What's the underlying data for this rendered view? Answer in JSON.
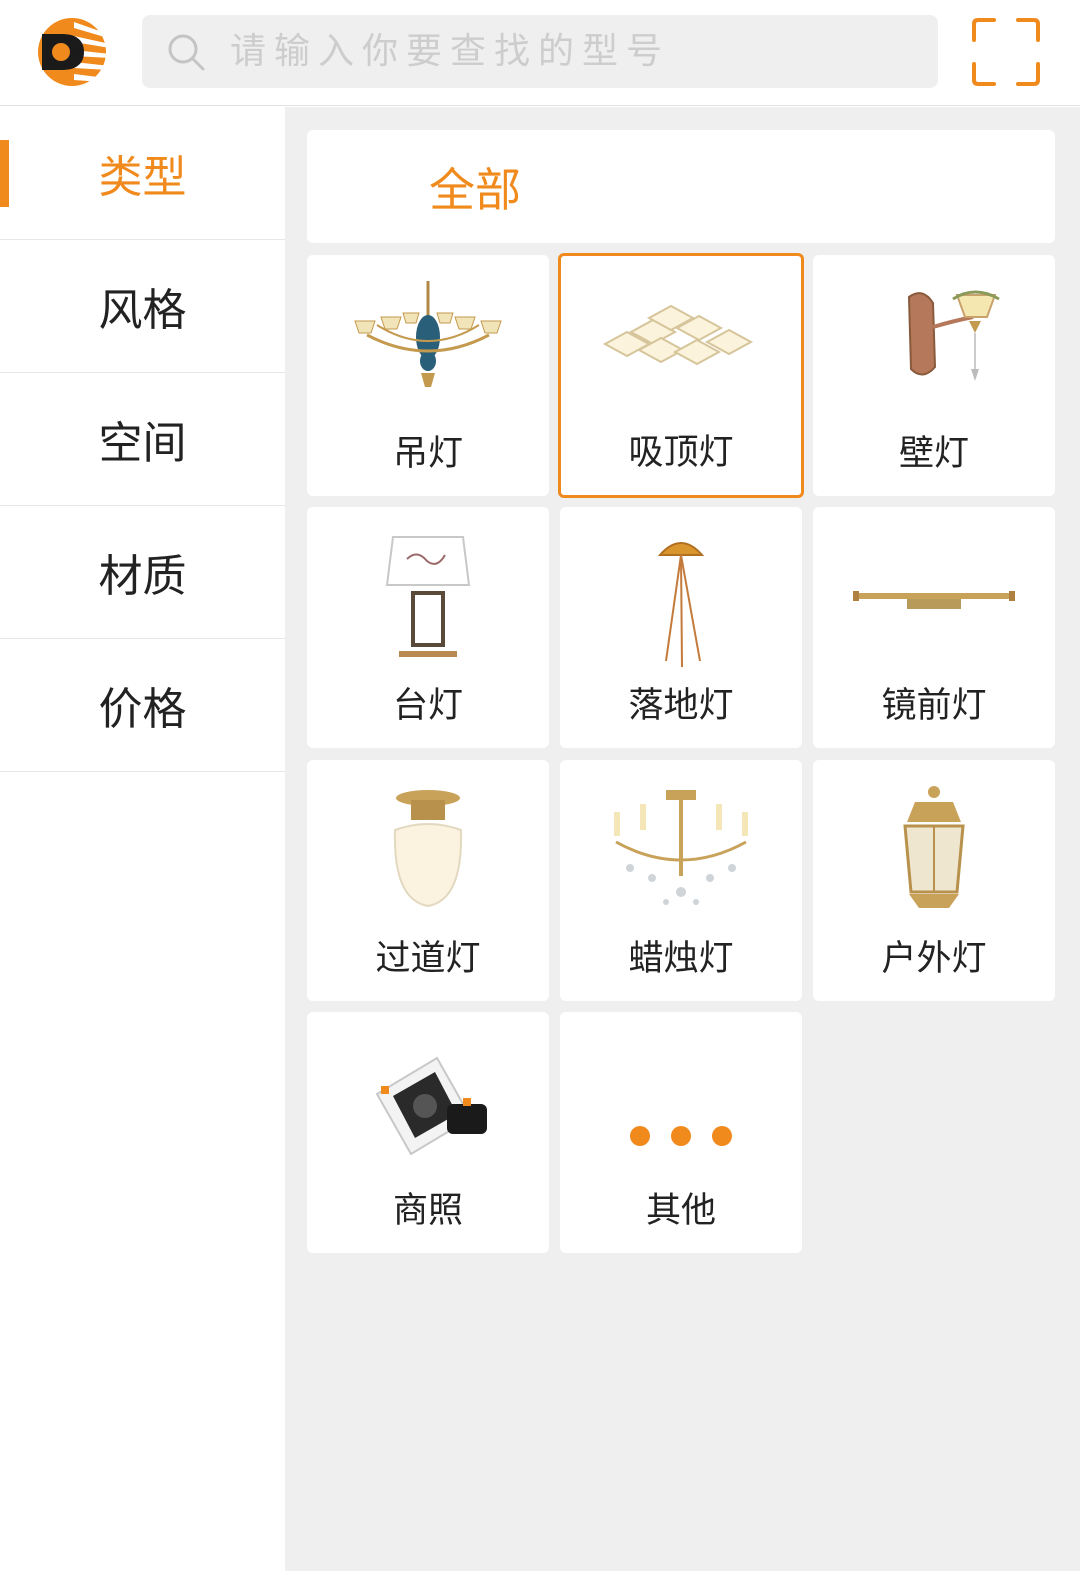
{
  "header": {
    "logo_icon": "brand-logo",
    "search_placeholder": "请输入你要查找的型号",
    "search_icon": "search-icon",
    "scan_icon": "scan-icon",
    "accent_color": "#f08a1c"
  },
  "sidebar": {
    "items": [
      {
        "label": "类型",
        "active": true
      },
      {
        "label": "风格",
        "active": false
      },
      {
        "label": "空间",
        "active": false
      },
      {
        "label": "材质",
        "active": false
      },
      {
        "label": "价格",
        "active": false
      }
    ]
  },
  "main": {
    "all_label": "全部",
    "categories": [
      {
        "label": "吊灯",
        "icon": "chandelier-icon",
        "selected": false
      },
      {
        "label": "吸顶灯",
        "icon": "ceiling-light-icon",
        "selected": true
      },
      {
        "label": "壁灯",
        "icon": "wall-lamp-icon",
        "selected": false
      },
      {
        "label": "台灯",
        "icon": "table-lamp-icon",
        "selected": false
      },
      {
        "label": "落地灯",
        "icon": "floor-lamp-icon",
        "selected": false
      },
      {
        "label": "镜前灯",
        "icon": "mirror-light-icon",
        "selected": false
      },
      {
        "label": "过道灯",
        "icon": "aisle-light-icon",
        "selected": false
      },
      {
        "label": "蜡烛灯",
        "icon": "candle-chandelier-icon",
        "selected": false
      },
      {
        "label": "户外灯",
        "icon": "outdoor-lantern-icon",
        "selected": false
      },
      {
        "label": "商照",
        "icon": "commercial-spotlight-icon",
        "selected": false
      },
      {
        "label": "其他",
        "icon": "more-dots-icon",
        "selected": false
      }
    ]
  }
}
